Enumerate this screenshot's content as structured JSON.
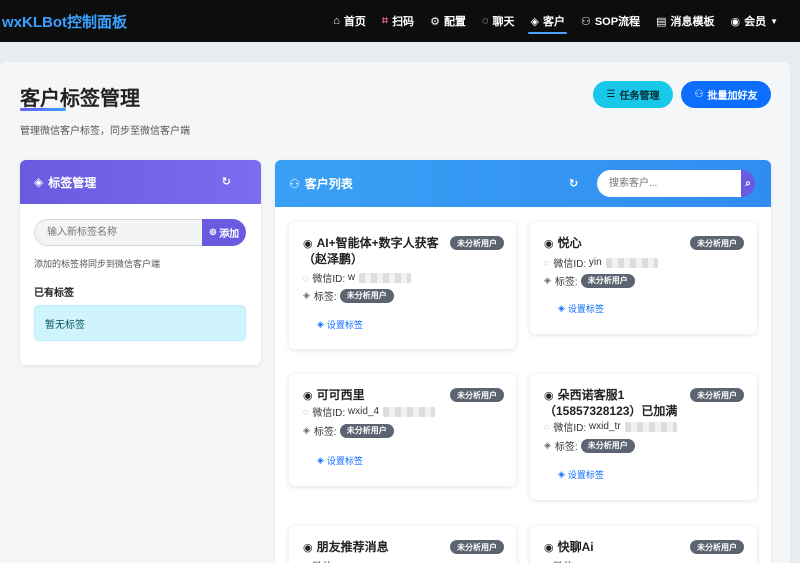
{
  "navbar": {
    "brand": "wxKLBot控制面板",
    "items": [
      {
        "icon": "home-icon",
        "glyph": "⌂",
        "label": "首页",
        "active": false
      },
      {
        "icon": "qr-icon",
        "glyph": "⌗",
        "label": "扫码",
        "active": false
      },
      {
        "icon": "gear-icon",
        "glyph": "⚙",
        "label": "配置",
        "active": false
      },
      {
        "icon": "chat-icon",
        "glyph": "◌",
        "label": "聊天",
        "active": false
      },
      {
        "icon": "tag-icon",
        "glyph": "◈",
        "label": "客户",
        "active": true
      },
      {
        "icon": "users-icon",
        "glyph": "⚇",
        "label": "SOP流程",
        "active": false
      },
      {
        "icon": "template-icon",
        "glyph": "▤",
        "label": "消息模板",
        "active": false
      },
      {
        "icon": "user-icon",
        "glyph": "◉",
        "label": "会员",
        "active": false
      }
    ]
  },
  "page": {
    "title": "客户标签管理",
    "subtitle": "管理微信客户标签，同步至微信客户端",
    "task_button": "任务管理",
    "batch_button": "批量加好友"
  },
  "tag_panel": {
    "title": "标签管理",
    "input_placeholder": "输入新标签名称",
    "add_label": "添加",
    "hint": "添加的标签将同步到微信客户端",
    "existing_label": "已有标签",
    "empty_text": "暂无标签"
  },
  "customer_panel": {
    "title": "客户列表",
    "search_placeholder": "搜索客户...",
    "wechat_id_label": "微信ID:",
    "tag_label": "标签:",
    "set_tag_label": "设置标签",
    "customers": [
      {
        "name_line1": "AI+智能体+数字人获客",
        "name_line2": "（赵泽鹏）",
        "status": "未分析用户",
        "wechat_id": "w",
        "tag": "未分析用户"
      },
      {
        "name_line1": "悦心",
        "name_line2": "",
        "status": "未分析用户",
        "wechat_id": "yin",
        "tag": "未分析用户"
      },
      {
        "name_line1": "可可西里",
        "name_line2": "",
        "status": "未分析用户",
        "wechat_id": "wxid_4",
        "tag": "未分析用户"
      },
      {
        "name_line1": "朵西诺客服1",
        "name_line2": "（15857328123）已加满",
        "status": "未分析用户",
        "wechat_id": "wxid_tr",
        "tag": "未分析用户"
      },
      {
        "name_line1": "朋友推荐消息",
        "name_line2": "",
        "status": "未分析用户",
        "wechat_id": "",
        "tag": ""
      },
      {
        "name_line1": "快聊Ai",
        "name_line2": "",
        "status": "未分析用户",
        "wechat_id": "",
        "tag": ""
      }
    ]
  },
  "colors": {
    "brand": "#3aa0ff",
    "tag_header": "#6a5ae0",
    "customer_header": "#3aa0f5",
    "badge": "#5b6470",
    "link": "#0d6efd"
  }
}
